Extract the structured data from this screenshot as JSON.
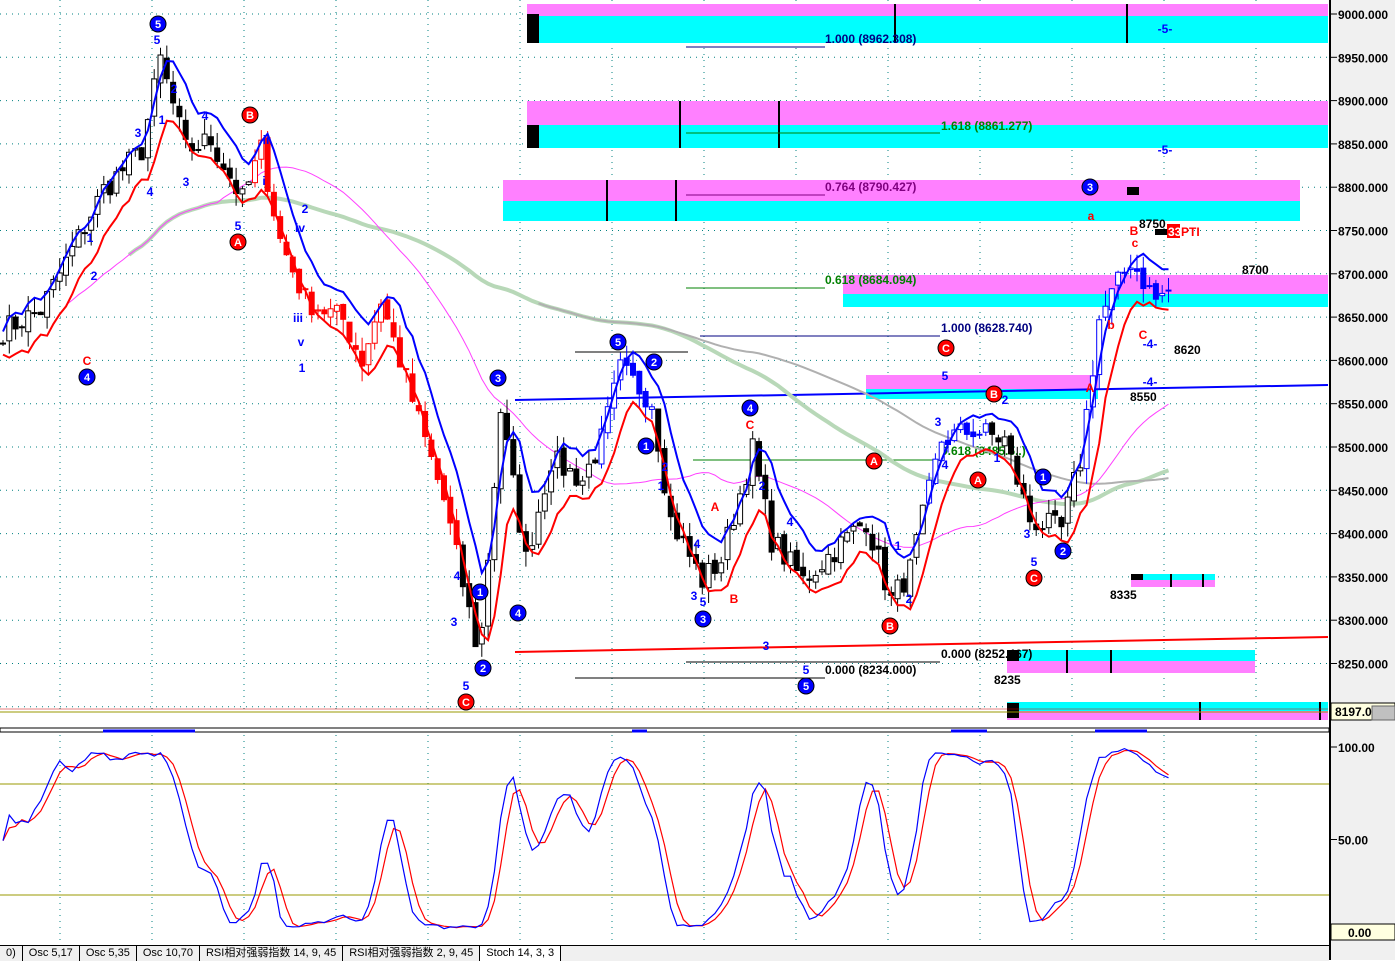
{
  "price_axis": {
    "ticks": [
      "9000.000",
      "8950.000",
      "8900.000",
      "8850.000",
      "8800.000",
      "8750.000",
      "8700.000",
      "8650.000",
      "8600.000",
      "8550.000",
      "8500.000",
      "8450.000",
      "8400.000",
      "8350.000",
      "8300.000",
      "8250.000"
    ],
    "current_price": "8197.0"
  },
  "osc_axis": {
    "ticks": [
      "100.00",
      "50.00"
    ],
    "current": "0.00"
  },
  "fib_labels": [
    {
      "t": "1.000 (8962.308)",
      "c": "#000080"
    },
    {
      "t": "1.618 (8861.277)",
      "c": "#008000"
    },
    {
      "t": "0.764 (8790.427)",
      "c": "#800080"
    },
    {
      "t": "0.618 (8684.094)",
      "c": "#008000"
    },
    {
      "t": "1.000 (8628.740)",
      "c": "#000080"
    },
    {
      "t": "0.618 (8485.5..)",
      "c": "#008000"
    },
    {
      "t": "0.000 (8252.467)",
      "c": "#000000"
    },
    {
      "t": "0.000 (8234.000)",
      "c": "#000000"
    }
  ],
  "level_labels": [
    "8750",
    "8700",
    "8620",
    "8550",
    "8335",
    "8235"
  ],
  "pti_label": {
    "num": "33",
    "text": "PTI"
  },
  "wave_labels": [
    {
      "t": "5",
      "c": "b",
      "o": 1
    },
    {
      "t": "4",
      "c": "b",
      "o": 1
    },
    {
      "t": "3",
      "c": "b",
      "o": 1
    },
    {
      "t": "1",
      "c": "b",
      "o": 1
    },
    {
      "t": "2",
      "c": "b",
      "o": 1
    },
    {
      "t": "4",
      "c": "b",
      "o": 1
    },
    {
      "t": "5",
      "c": "b",
      "o": 1
    },
    {
      "t": "2",
      "c": "b",
      "o": 1
    },
    {
      "t": "1",
      "c": "b",
      "o": 1
    },
    {
      "t": "4",
      "c": "b",
      "o": 1
    },
    {
      "t": "3",
      "c": "b",
      "o": 1
    },
    {
      "t": "5",
      "c": "b",
      "o": 1
    },
    {
      "t": "3",
      "c": "b",
      "o": 1
    },
    {
      "t": "1",
      "c": "b",
      "o": 1
    },
    {
      "t": "2",
      "c": "b",
      "o": 1
    },
    {
      "t": "B",
      "c": "r",
      "o": 1
    },
    {
      "t": "A",
      "c": "r",
      "o": 1
    },
    {
      "t": "C",
      "c": "r",
      "o": 1
    },
    {
      "t": "C",
      "c": "r",
      "o": 1
    },
    {
      "t": "A",
      "c": "r",
      "o": 1
    },
    {
      "t": "B",
      "c": "r",
      "o": 1
    },
    {
      "t": "B",
      "c": "r",
      "o": 1
    },
    {
      "t": "A",
      "c": "r",
      "o": 1
    },
    {
      "t": "C",
      "c": "r",
      "o": 1
    },
    {
      "t": "5",
      "c": "b"
    },
    {
      "t": "2",
      "c": "b"
    },
    {
      "t": "1",
      "c": "b"
    },
    {
      "t": "3",
      "c": "b"
    },
    {
      "t": "4",
      "c": "b"
    },
    {
      "t": "4",
      "c": "b"
    },
    {
      "t": "3",
      "c": "b"
    },
    {
      "t": "ii",
      "c": "b"
    },
    {
      "t": "i",
      "c": "b"
    },
    {
      "t": "5",
      "c": "b"
    },
    {
      "t": "2",
      "c": "b"
    },
    {
      "t": "iv",
      "c": "b"
    },
    {
      "t": "iii",
      "c": "b"
    },
    {
      "t": "v",
      "c": "b"
    },
    {
      "t": "1",
      "c": "b"
    },
    {
      "t": "1",
      "c": "b"
    },
    {
      "t": "2",
      "c": "b"
    },
    {
      "t": "4",
      "c": "b"
    },
    {
      "t": "3",
      "c": "b"
    },
    {
      "t": "5",
      "c": "b"
    },
    {
      "t": "2",
      "c": "b"
    },
    {
      "t": "1",
      "c": "b"
    },
    {
      "t": "4",
      "c": "b"
    },
    {
      "t": "3",
      "c": "b"
    },
    {
      "t": "5",
      "c": "b"
    },
    {
      "t": "2",
      "c": "b"
    },
    {
      "t": "4",
      "c": "b"
    },
    {
      "t": "3",
      "c": "b"
    },
    {
      "t": "5",
      "c": "b"
    },
    {
      "t": "1",
      "c": "b"
    },
    {
      "t": "2",
      "c": "b"
    },
    {
      "t": "5",
      "c": "b"
    },
    {
      "t": "4",
      "c": "b"
    },
    {
      "t": "3",
      "c": "b"
    },
    {
      "t": "2",
      "c": "b"
    },
    {
      "t": "1",
      "c": "b"
    },
    {
      "t": "3",
      "c": "b"
    },
    {
      "t": "5",
      "c": "b"
    },
    {
      "t": "-5-",
      "c": "b"
    },
    {
      "t": "-5-",
      "c": "b"
    },
    {
      "t": "-4-",
      "c": "b"
    },
    {
      "t": "-4-",
      "c": "b"
    },
    {
      "t": "C",
      "c": "r"
    },
    {
      "t": "A",
      "c": "r"
    },
    {
      "t": "C",
      "c": "r"
    },
    {
      "t": "B",
      "c": "r"
    },
    {
      "t": "a",
      "c": "r"
    },
    {
      "t": "b",
      "c": "r"
    },
    {
      "t": "B",
      "c": "r"
    },
    {
      "t": "c",
      "c": "r"
    },
    {
      "t": "C",
      "c": "r"
    },
    {
      "t": "A",
      "c": "r"
    }
  ],
  "tabs": [
    "0)",
    "Osc 5,17",
    "Osc 5,35",
    "Osc 10,70",
    "RSI相对强弱指数 14, 9, 45",
    "RSI相对强弱指数 2, 9, 45",
    "Stoch 14, 3, 3"
  ],
  "active_tab": 6,
  "colors": {
    "upper_band": "#0000ff",
    "lower_band": "#ff0000",
    "zone_pink": "#ff80ff",
    "zone_cyan": "#00ffff",
    "ma_slow": "#b8d8b8",
    "ma_mid": "#ff40ff",
    "ma_long": "#b0b0b0",
    "stoch_k": "#0000ff",
    "stoch_d": "#ff0000",
    "ref_line": "#999900"
  },
  "chart_data": {
    "type": "candlestick",
    "ylim": [
      8197,
      9010
    ],
    "price_path": [
      [
        0,
        8635
      ],
      [
        6,
        8658
      ],
      [
        16,
        8797
      ],
      [
        22,
        8843
      ],
      [
        25,
        8947
      ],
      [
        29,
        8843
      ],
      [
        33,
        8854
      ],
      [
        38,
        8785
      ],
      [
        41,
        8843
      ],
      [
        44,
        8739
      ],
      [
        48,
        8670
      ],
      [
        54,
        8647
      ],
      [
        57,
        8600
      ],
      [
        60,
        8670
      ],
      [
        65,
        8554
      ],
      [
        70,
        8439
      ],
      [
        75,
        8277
      ],
      [
        76,
        8289
      ],
      [
        79,
        8543
      ],
      [
        83,
        8370
      ],
      [
        87,
        8485
      ],
      [
        92,
        8462
      ],
      [
        95,
        8508
      ],
      [
        98,
        8589
      ],
      [
        103,
        8554
      ],
      [
        106,
        8416
      ],
      [
        111,
        8346
      ],
      [
        114,
        8370
      ],
      [
        119,
        8497
      ],
      [
        122,
        8393
      ],
      [
        127,
        8346
      ],
      [
        132,
        8381
      ],
      [
        137,
        8416
      ],
      [
        141,
        8323
      ],
      [
        144,
        8358
      ],
      [
        149,
        8508
      ],
      [
        154,
        8520
      ],
      [
        159,
        8508
      ],
      [
        163,
        8416
      ],
      [
        168,
        8404
      ],
      [
        171,
        8485
      ],
      [
        174,
        8647
      ],
      [
        179,
        8716
      ],
      [
        183,
        8670
      ],
      [
        185,
        8681
      ]
    ],
    "oscillator": {
      "name": "Stoch 14, 3, 3",
      "ylim": [
        0,
        100
      ],
      "ref_levels": [
        80,
        20
      ]
    }
  }
}
